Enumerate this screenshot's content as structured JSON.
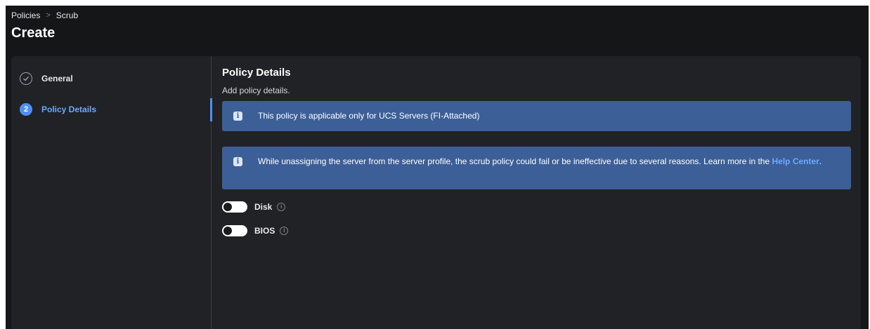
{
  "breadcrumb": {
    "items": [
      "Policies",
      "Scrub"
    ],
    "separator": ">"
  },
  "page": {
    "title": "Create"
  },
  "steps": [
    {
      "label": "General",
      "state": "completed",
      "icon": "check-circle-icon"
    },
    {
      "number": "2",
      "label": "Policy Details",
      "state": "active"
    }
  ],
  "section": {
    "title": "Policy Details",
    "subtitle": "Add policy details."
  },
  "banners": [
    {
      "icon": "info-icon",
      "text": "This policy is applicable only for UCS Servers (FI-Attached)"
    },
    {
      "icon": "info-icon",
      "text": "While unassigning the server from the server profile, the scrub policy could fail or be ineffective due to several reasons. Learn more in the",
      "link": "Help Center",
      "suffix": "."
    }
  ],
  "toggles": [
    {
      "label": "Disk",
      "on": false
    },
    {
      "label": "BIOS",
      "on": false
    }
  ],
  "colors": {
    "background": "#151618",
    "panel": "#202226",
    "accent": "#4f8ff7",
    "banner": "#3c5f98",
    "link": "#6fa8ff"
  }
}
